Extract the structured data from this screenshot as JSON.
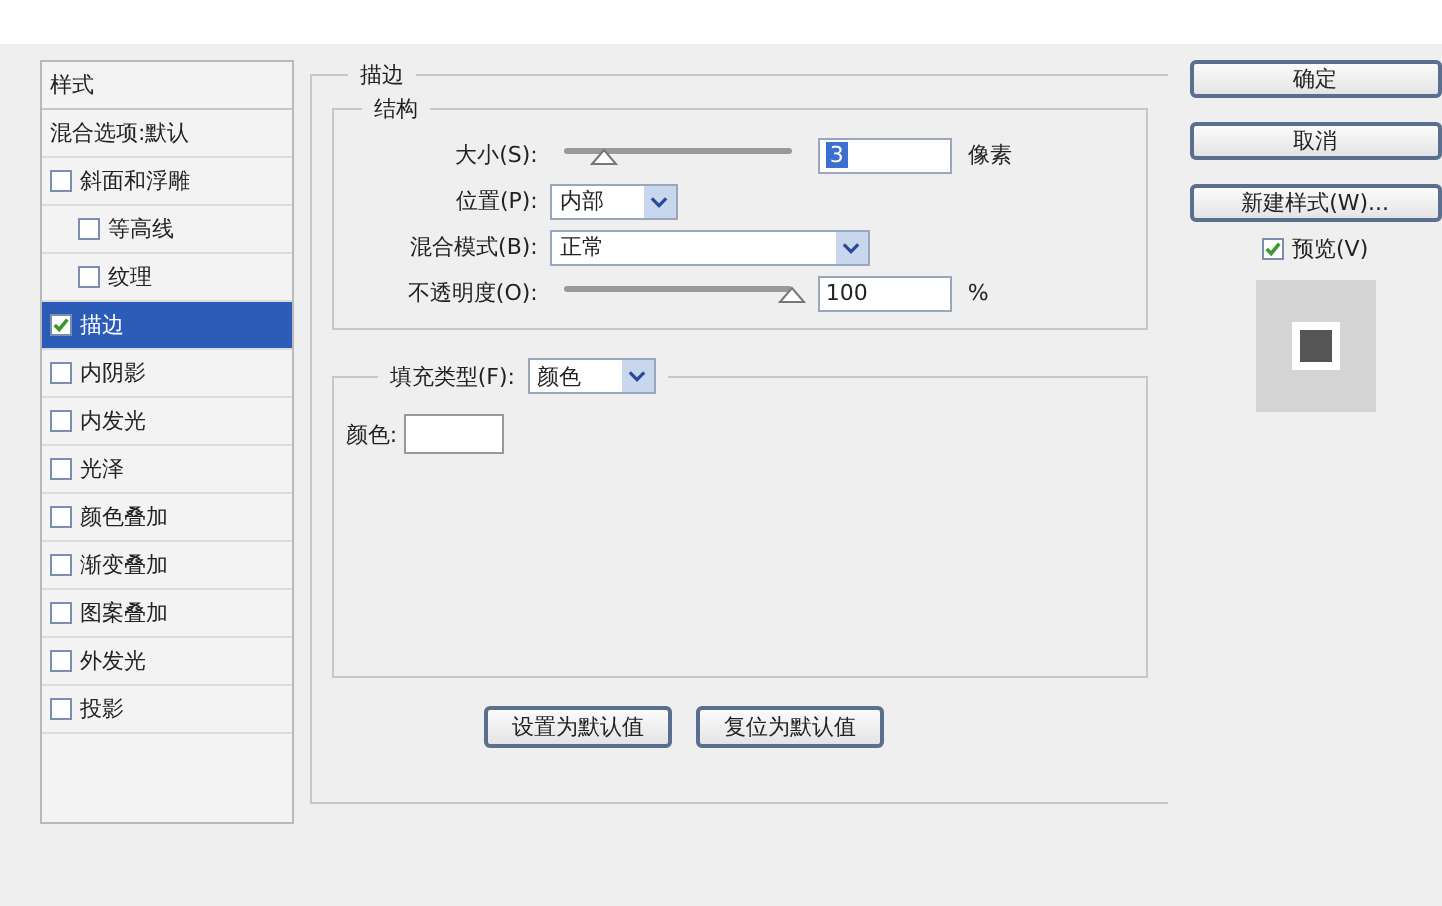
{
  "styles": {
    "header": "样式",
    "items": [
      {
        "label": "混合选项:默认",
        "kind": "plain",
        "selected": false
      },
      {
        "label": "斜面和浮雕",
        "kind": "checkbox",
        "checked": false,
        "selected": false,
        "children": [
          {
            "label": "等高线",
            "kind": "checkbox",
            "checked": false,
            "selected": false
          },
          {
            "label": "纹理",
            "kind": "checkbox",
            "checked": false,
            "selected": false
          }
        ]
      },
      {
        "label": "描边",
        "kind": "checkbox",
        "checked": true,
        "selected": true
      },
      {
        "label": "内阴影",
        "kind": "checkbox",
        "checked": false,
        "selected": false
      },
      {
        "label": "内发光",
        "kind": "checkbox",
        "checked": false,
        "selected": false
      },
      {
        "label": "光泽",
        "kind": "checkbox",
        "checked": false,
        "selected": false
      },
      {
        "label": "颜色叠加",
        "kind": "checkbox",
        "checked": false,
        "selected": false
      },
      {
        "label": "渐变叠加",
        "kind": "checkbox",
        "checked": false,
        "selected": false
      },
      {
        "label": "图案叠加",
        "kind": "checkbox",
        "checked": false,
        "selected": false
      },
      {
        "label": "外发光",
        "kind": "checkbox",
        "checked": false,
        "selected": false
      },
      {
        "label": "投影",
        "kind": "checkbox",
        "checked": false,
        "selected": false
      }
    ]
  },
  "stroke": {
    "title": "描边",
    "structure": {
      "title": "结构",
      "size": {
        "label": "大小(S):",
        "level": 0.18,
        "value": "3",
        "unit": "像素"
      },
      "position": {
        "label": "位置(P):",
        "value": "内部"
      },
      "blend_mode": {
        "label": "混合模式(B):",
        "value": "正常"
      },
      "opacity": {
        "label": "不透明度(O):",
        "level": 1,
        "value": "100",
        "unit": "%"
      }
    },
    "fill": {
      "type_label": "填充类型(F):",
      "type_value": "颜色",
      "color_label": "颜色:",
      "color": "#ffffff"
    },
    "buttons": [
      "设置为默认值",
      "复位为默认值"
    ]
  },
  "actions": {
    "buttons": [
      "确定",
      "取消",
      "新建样式(W)..."
    ],
    "preview": {
      "label": "预览(V)",
      "checked": true
    }
  }
}
